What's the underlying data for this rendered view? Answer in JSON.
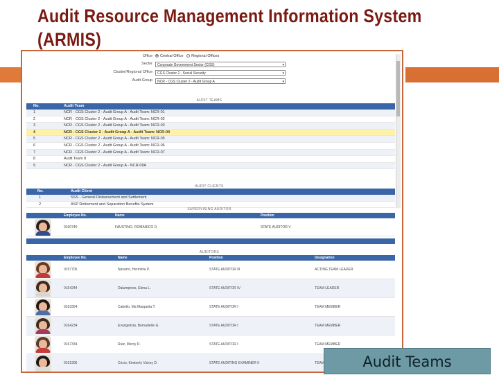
{
  "slide": {
    "title_line1": "Audit Resource Management Information System",
    "title_line2": "(ARMIS)",
    "caption": "Audit Teams"
  },
  "filters": {
    "office_label": "Office",
    "office_options": [
      "Central Office",
      "Regional Offices"
    ],
    "office_selected": "Central Office",
    "sector_label": "Sector",
    "sector_value": "Corporate Government Sector (CGS)",
    "cluster_label": "Cluster/Regional Office",
    "cluster_value": "CGS Cluster 2 - Social Security",
    "group_label": "Audit Group",
    "group_value": "NCR - CGS Cluster 2 - Audit Group A"
  },
  "audit_teams": {
    "section_title": "AUDIT TEAMS",
    "columns": [
      "No.",
      "Audit Team"
    ],
    "rows": [
      {
        "no": "1",
        "name": "NCR - CGS Cluster 2 - Audit Group A - Audit Team: NCR-01"
      },
      {
        "no": "2",
        "name": "NCR - CGS Cluster 2 - Audit Group A - Audit Team: NCR-02"
      },
      {
        "no": "3",
        "name": "NCR - CGS Cluster 2 - Audit Group A - Audit Team: NCR-03"
      },
      {
        "no": "4",
        "name": "NCR - CGS Cluster 2 - Audit Group A - Audit Team: NCR-04"
      },
      {
        "no": "5",
        "name": "NCR - CGS Cluster 2 - Audit Group A - Audit Team: NCR-05"
      },
      {
        "no": "6",
        "name": "NCR - CGS Cluster 2 - Audit Group A - Audit Team: NCR-06"
      },
      {
        "no": "7",
        "name": "NCR - CGS Cluster 2 - Audit Group A - Audit Team: NCR-07"
      },
      {
        "no": "8",
        "name": "Audit Team 8"
      },
      {
        "no": "9",
        "name": "NCR - CGS Cluster 2 - Audit Group A - NCR-09A"
      }
    ],
    "selected_no": "4"
  },
  "audit_clients": {
    "section_title": "AUDIT CLIENTS",
    "columns": [
      "No.",
      "Audit Client"
    ],
    "rows": [
      {
        "no": "1",
        "name": "SSS - General Disbursement and Settlement"
      },
      {
        "no": "2",
        "name": "ASP Retirement and Separation Benefits System"
      }
    ]
  },
  "supervising_auditor": {
    "section_title": "SUPERVISING AUDITOR",
    "columns": [
      "Employee No.",
      "Name",
      "Position"
    ],
    "rows": [
      {
        "emp": "0160740",
        "name": "FAUSTINO, ROMARICO D.",
        "position": "STATE AUDITOR V"
      }
    ]
  },
  "auditors": {
    "section_title": "AUDITORS",
    "columns": [
      "Employee No.",
      "Name",
      "Position",
      "Designation"
    ],
    "rows": [
      {
        "emp": "0157705",
        "name": "Navarro, Herminia P.",
        "position": "STATE AUDITOR III",
        "designation": "ACTING TEAM LEADER"
      },
      {
        "emp": "0154244",
        "name": "Dalumpines, Elena L.",
        "position": "STATE AUDITOR IV",
        "designation": "TEAM LEADER"
      },
      {
        "emp": "0163354",
        "name": "Cabello, Ma Margarita T.",
        "position": "STATE AUDITOR I",
        "designation": "TEAM MEMBER"
      },
      {
        "emp": "0164234",
        "name": "Evangelista, Bernadette G.",
        "position": "STATE AUDITOR I",
        "designation": "TEAM MEMBER"
      },
      {
        "emp": "0167334",
        "name": "Ruiz, Mercy D.",
        "position": "STATE AUDITOR I",
        "designation": "TEAM MEMBER"
      },
      {
        "emp": "0161305",
        "name": "Cricio, Kimberly Vickey D.",
        "position": "STATE AUDITING EXAMINER II",
        "designation": "TEAM MEMBER"
      }
    ]
  },
  "colors": {
    "title": "#7a1a12",
    "accent": "#e07a3a",
    "grid_header": "#3a66a8",
    "selected_row": "#fff1a6",
    "caption_bg": "#6e9aa5"
  }
}
